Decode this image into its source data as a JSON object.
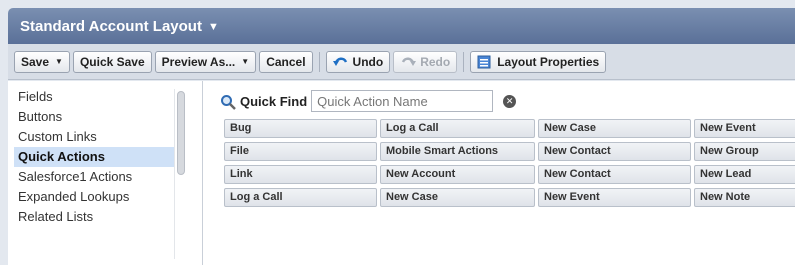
{
  "header": {
    "title": "Standard Account Layout"
  },
  "toolbar": {
    "save": "Save",
    "quick_save": "Quick Save",
    "preview_as": "Preview As...",
    "cancel": "Cancel",
    "undo": "Undo",
    "redo": "Redo",
    "layout_properties": "Layout Properties"
  },
  "sidebar": {
    "items": [
      {
        "label": "Fields"
      },
      {
        "label": "Buttons"
      },
      {
        "label": "Custom Links"
      },
      {
        "label": "Quick Actions",
        "active": true
      },
      {
        "label": "Salesforce1 Actions"
      },
      {
        "label": "Expanded Lookups"
      },
      {
        "label": "Related Lists"
      }
    ]
  },
  "quick_find": {
    "label": "Quick Find",
    "placeholder": "Quick Action Name"
  },
  "actions_grid": {
    "rows": [
      [
        "Bug",
        "Log a Call",
        "New Case",
        "New Event"
      ],
      [
        "File",
        "Mobile Smart Actions",
        "New Contact",
        "New Group"
      ],
      [
        "Link",
        "New Account",
        "New Contact",
        "New Lead"
      ],
      [
        "Log a Call",
        "New Case",
        "New Event",
        "New Note"
      ]
    ]
  },
  "colors": {
    "header_bg": "#6a80a6",
    "active_item_bg": "#cfe1f7",
    "undo_icon": "#1f6fc4"
  },
  "icons": [
    "chevron-down-icon",
    "undo-icon",
    "redo-icon",
    "layout-properties-icon",
    "magnifier-icon",
    "clear-icon"
  ]
}
